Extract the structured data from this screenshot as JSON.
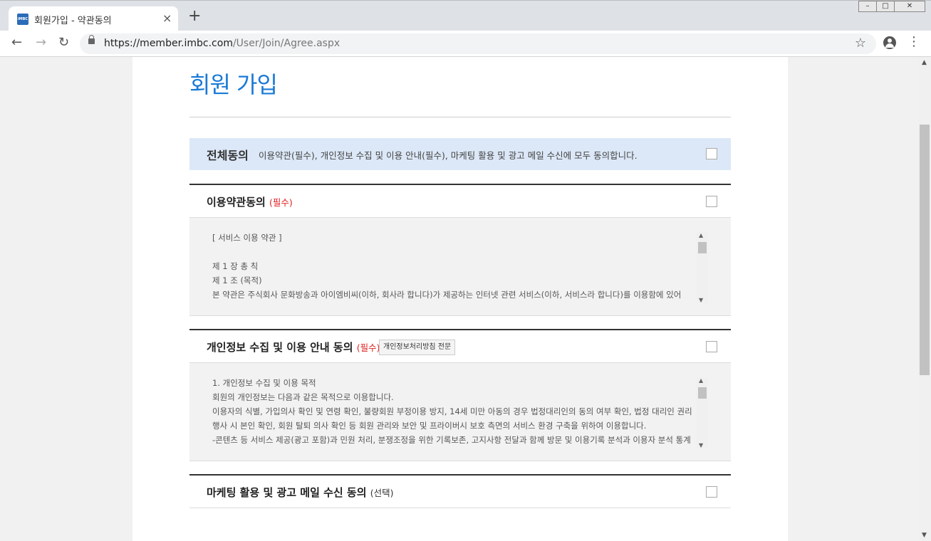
{
  "browser": {
    "tab_title": "회원가입 - 약관동의",
    "favicon_text": "iMBC",
    "new_tab": "+",
    "close_tab": "×",
    "url_host": "https://member.imbc.com",
    "url_path": "/User/Join/Agree.aspx"
  },
  "page": {
    "title": "회원 가입",
    "all_agree": {
      "label": "전체동의",
      "desc": "이용약관(필수), 개인정보 수집 및 이용 안내(필수), 마케팅 활용 및 광고 메일 수신에 모두 동의합니다."
    },
    "sections": [
      {
        "title": "이용약관동의",
        "tag": "(필수)",
        "lines": [
          "[ 서비스 이용 약관 ]",
          "",
          "제 1 장 총 칙",
          "제 1 조 (목적)",
          "본 약관은 주식회사 문화방송과 아이엠비씨(이하, 회사라 합니다)가 제공하는 인터넷 관련 서비스(이하, 서비스라 합니다)를 이용함에 있어"
        ]
      },
      {
        "title": "개인정보 수집 및 이용 안내 동의",
        "tag": "(필수)",
        "button": "개인정보처리방침 전문",
        "lines": [
          "1. 개인정보 수집 및 이용 목적",
          "회원의 개인정보는 다음과 같은 목적으로 이용합니다.",
          "이용자의 식별, 가입의사 확인 및 연령 확인, 불량회원 부정이용 방지, 14세 미만 아동의 경우 법정대리인의 동의 여부 확인, 법정 대리인 권리",
          "행사 시 본인 확인, 회원 탈퇴 의사 확인 등 회원 관리와 보안 및 프라이버시 보호 측면의 서비스 환경 구축을 위하여 이용합니다.",
          "-콘텐츠 등 서비스 제공(광고 포함)과 민원 처리, 분쟁조정을 위한 기록보존, 고지사항 전달과 함께 방문 및 이용기록 분석과 이용자 분석 통계"
        ]
      },
      {
        "title": "마케팅 활용 및 광고 메일 수신 동의",
        "tag": "(선택)"
      }
    ]
  }
}
